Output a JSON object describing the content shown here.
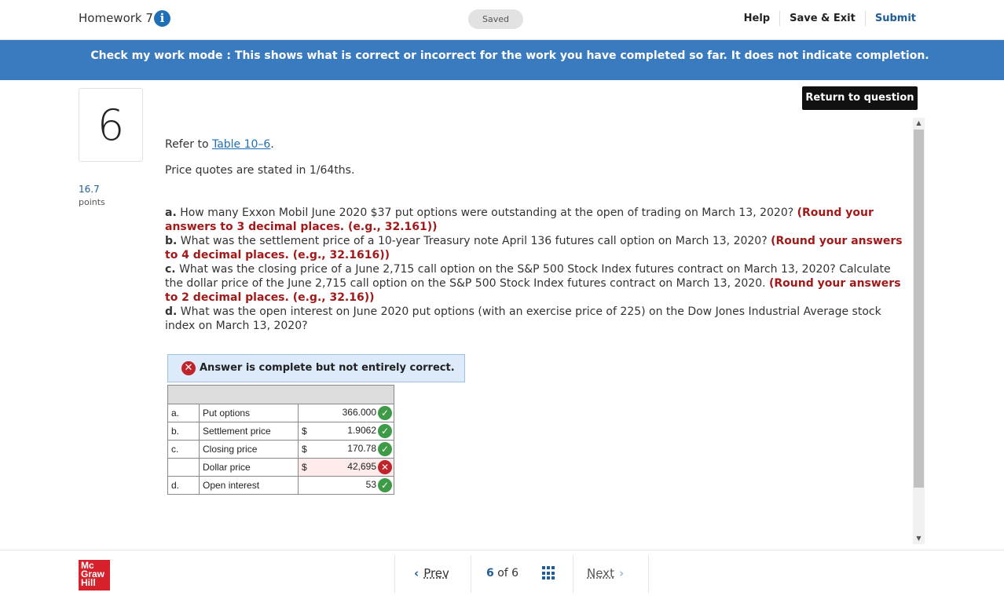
{
  "header": {
    "title": "Homework 7",
    "status": "Saved",
    "help": "Help",
    "save_exit": "Save & Exit",
    "submit": "Submit"
  },
  "banner": "Check my work mode : This shows what is correct or incorrect for the work you have completed so far. It does not indicate completion.",
  "return_button": "Return to question",
  "question": {
    "number": "6",
    "points_value": "16.7",
    "points_label": "points",
    "refer_prefix": "Refer to ",
    "refer_link": "Table 10–6",
    "refer_suffix": ".",
    "quotes_note": "Price quotes are stated in 1/64ths.",
    "part_a_label": "a.",
    "part_a_text": " How many Exxon Mobil June 2020 $37 put options were outstanding at the open of trading on March 13, 2020? ",
    "part_a_hint": "(Round your answers to 3 decimal places. (e.g., 32.161))",
    "part_b_label": "b.",
    "part_b_text": " What was the settlement price of a 10-year Treasury note April 136 futures call option on March 13, 2020? ",
    "part_b_hint": "(Round your answers to 4 decimal places. (e.g., 32.1616))",
    "part_c_label": "c.",
    "part_c_text": " What was the closing price of a June 2,715 call option on the S&P 500 Stock Index futures contract on March 13, 2020? Calculate the dollar price of the June 2,715 call option on the S&P 500 Stock Index futures contract on March 13, 2020. ",
    "part_c_hint": "(Round your answers to 2 decimal places. (e.g., 32.16))",
    "part_d_label": "d.",
    "part_d_text": " What was the open interest on June 2020 put options (with an exercise price of 225) on the Dow Jones Industrial Average stock index on March 13, 2020?"
  },
  "result": {
    "message": "Answer is complete but not entirely correct.",
    "rows": [
      {
        "letter": "a.",
        "label": "Put options",
        "currency": "",
        "value": "366.000",
        "correct": true
      },
      {
        "letter": "b.",
        "label": "Settlement price",
        "currency": "$",
        "value": "1.9062",
        "correct": true
      },
      {
        "letter": "c.",
        "label": "Closing price",
        "currency": "$",
        "value": "170.78",
        "correct": true
      },
      {
        "letter": "",
        "label": "Dollar price",
        "currency": "$",
        "value": "42,695",
        "correct": false
      },
      {
        "letter": "d.",
        "label": "Open interest",
        "currency": "",
        "value": "53",
        "correct": true
      }
    ]
  },
  "footer": {
    "logo_line1": "Mc",
    "logo_line2": "Graw",
    "logo_line3": "Hill",
    "prev": "Prev",
    "page_current": "6",
    "page_of": "of",
    "page_total": "6",
    "next": "Next"
  },
  "colors": {
    "banner": "#3a7bc0",
    "correct": "#3d9a47",
    "incorrect": "#c0242b",
    "hint": "#a11a1a"
  }
}
